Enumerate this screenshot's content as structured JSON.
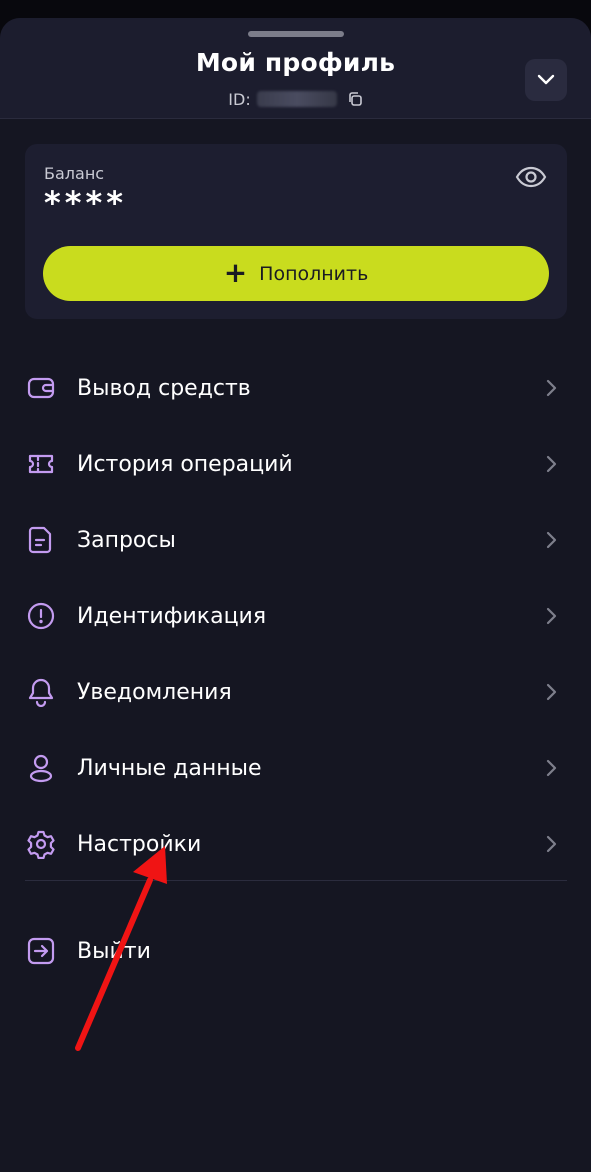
{
  "header": {
    "title": "Мой профиль",
    "id_label": "ID:",
    "collapse_icon": "chevron-down-icon"
  },
  "balance": {
    "label": "Баланс",
    "value": "****",
    "visibility_icon": "eye-icon",
    "topup_label": "Пополнить",
    "accent_color": "#c9dc1e"
  },
  "menu": {
    "items": [
      {
        "label": "Вывод средств",
        "icon": "wallet-icon"
      },
      {
        "label": "История операций",
        "icon": "ticket-icon"
      },
      {
        "label": "Запросы",
        "icon": "document-icon"
      },
      {
        "label": "Идентификация",
        "icon": "alert-circle-icon"
      },
      {
        "label": "Уведомления",
        "icon": "bell-icon"
      },
      {
        "label": "Личные данные",
        "icon": "user-icon"
      },
      {
        "label": "Настройки",
        "icon": "gear-icon"
      }
    ],
    "logout_label": "Выйти",
    "logout_icon": "logout-icon",
    "icon_color": "#c39bf0"
  },
  "annotation": {
    "arrow_color": "#f01414"
  }
}
